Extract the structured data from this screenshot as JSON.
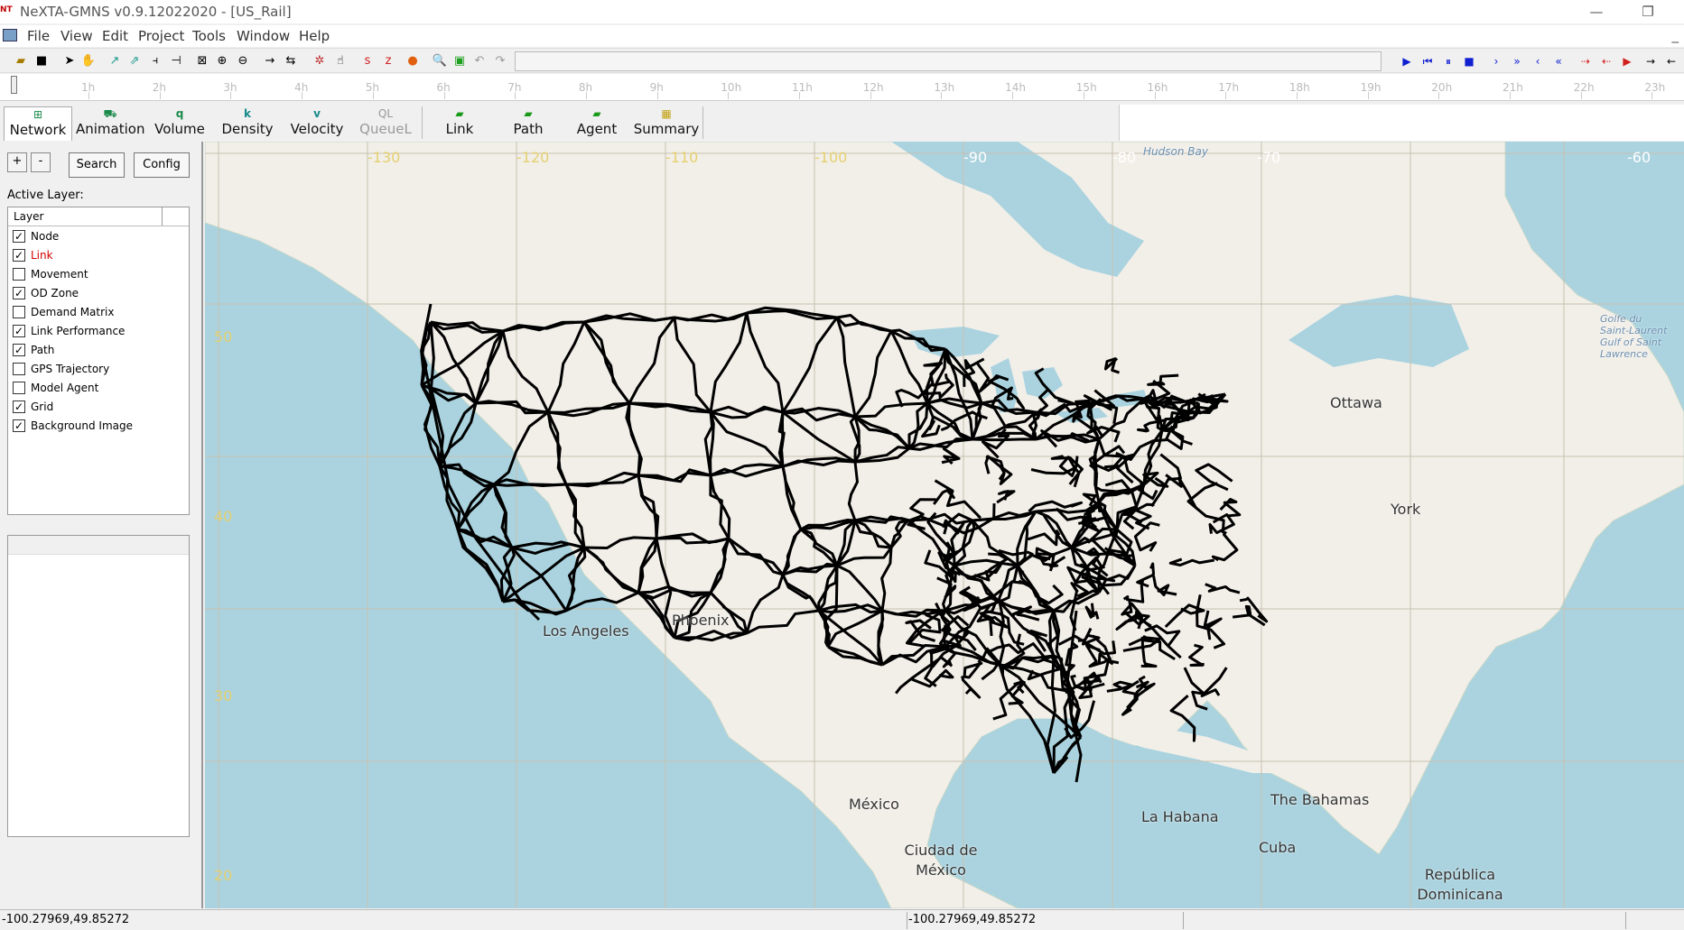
{
  "window": {
    "title": "NeXTA-GMNS v0.9.12022020 - [US_Rail]",
    "icon_text": "NT",
    "minimize": "—",
    "restore": "❐"
  },
  "menu": {
    "items": [
      "File",
      "View",
      "Edit",
      "Project",
      "Tools",
      "Window",
      "Help"
    ],
    "mdi_minimize": "_"
  },
  "timeline": {
    "hours": [
      "1h",
      "2h",
      "3h",
      "4h",
      "5h",
      "6h",
      "7h",
      "8h",
      "9h",
      "10h",
      "11h",
      "12h",
      "13h",
      "14h",
      "15h",
      "16h",
      "17h",
      "18h",
      "19h",
      "20h",
      "21h",
      "22h",
      "23h"
    ]
  },
  "modes": [
    {
      "label": "Network",
      "icon": "network-icon",
      "glyph": "⊞",
      "active": true
    },
    {
      "label": "Animation",
      "icon": "animation-icon",
      "glyph": "⛟"
    },
    {
      "label": "Volume",
      "icon": "volume-icon",
      "glyph": "q"
    },
    {
      "label": "Density",
      "icon": "density-icon",
      "glyph": "k"
    },
    {
      "label": "Velocity",
      "icon": "velocity-icon",
      "glyph": "v"
    },
    {
      "label": "QueueL",
      "icon": "queue-icon",
      "glyph": "QL",
      "disabled": true
    },
    {
      "label": "Link",
      "icon": "link-icon",
      "glyph": "▰"
    },
    {
      "label": "Path",
      "icon": "path-icon",
      "glyph": "▰"
    },
    {
      "label": "Agent",
      "icon": "agent-icon",
      "glyph": "▰"
    },
    {
      "label": "Summary",
      "icon": "summary-icon",
      "glyph": "▦"
    }
  ],
  "left_panel": {
    "plus": "+",
    "minus": "-",
    "search_label": "Search",
    "config_label": "Config",
    "active_layer_label": "Active Layer:",
    "layer_column_header": "Layer",
    "layers": [
      {
        "label": "Node",
        "checked": true
      },
      {
        "label": "Link",
        "checked": true,
        "highlight": true
      },
      {
        "label": "Movement",
        "checked": false
      },
      {
        "label": "OD Zone",
        "checked": true
      },
      {
        "label": "Demand Matrix",
        "checked": false
      },
      {
        "label": "Link Performance",
        "checked": true
      },
      {
        "label": "Path",
        "checked": true
      },
      {
        "label": "GPS Trajectory",
        "checked": false
      },
      {
        "label": "Model Agent",
        "checked": false
      },
      {
        "label": "Grid",
        "checked": true
      },
      {
        "label": "Background Image",
        "checked": true
      }
    ]
  },
  "map": {
    "longitude_labels": [
      "-130",
      "-120",
      "-110",
      "-100",
      "-90",
      "-80",
      "-70",
      "-60"
    ],
    "latitude_labels": [
      "50",
      "40",
      "30",
      "20"
    ],
    "place_labels": {
      "hudson_bay": "Hudson Bay",
      "ottawa": "Ottawa",
      "york": "York",
      "los_angeles": "Los Angeles",
      "phoenix": "Phoenix",
      "mexico": "México",
      "ciudad_de_mexico": "Ciudad de México",
      "la_habana": "La Habana",
      "bahamas": "The Bahamas",
      "cuba": "Cuba",
      "republica_dominicana": "República Dominicana",
      "gulf_st_lawrence": "Golfe du Saint-Laurent Gulf of Saint Lawrence"
    },
    "colors": {
      "water": "#aad3df",
      "land": "#f2efe9",
      "network": "#000000",
      "grid": "#c8c0b0"
    }
  },
  "status": {
    "left_coords": "-100.27969,49.85272",
    "center_coords": "-100.27969,49.85272"
  }
}
